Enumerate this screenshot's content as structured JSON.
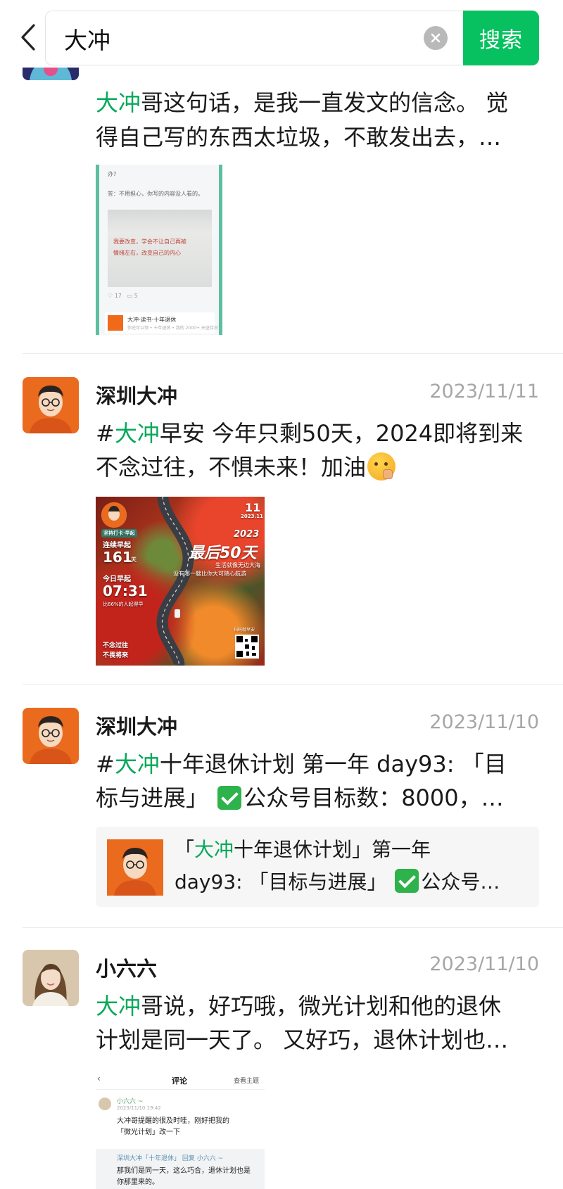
{
  "search": {
    "query": "大冲",
    "button_label": "搜索"
  },
  "posts": [
    {
      "text_line1_prefix": "哥这句话，是我一直发文的信念。 觉",
      "text_line2": "得自己写的东西太垃圾，不敢发出去，…",
      "highlight": "大冲",
      "image": {
        "question_tail": "办?",
        "answer": "答：不用担心，你写的内容没人看的。",
        "handwriting1": "我要改变，学会不让自己再被",
        "handwriting2": "情绪左右，改变自己的内心",
        "likes": "17",
        "comments": "5",
        "card_title": "大冲·读书·十年退休",
        "card_sub": "你还可以领 • 十年退休 • 我的 2000+ 天坚持日记"
      }
    },
    {
      "user": "深圳大冲",
      "date": "2023/11/11",
      "text_line1_hash": "#",
      "highlight": "大冲",
      "text_line1_rest": "早安 今年只剩50天，2024即将到来",
      "text_line2": "不念过往，不惧未来！加油",
      "image": {
        "badge": "坚持打卡·早起",
        "day": "11",
        "yearmonth": "2023.11",
        "year": "2023",
        "headline": "最后50天",
        "slogan1": "生活就像无边大海",
        "slogan2": "没有哪一艘比你大可随心航游",
        "streak_label": "连续早起",
        "streak_value": "161",
        "streak_unit": "天",
        "today_label": "今日早起",
        "today_time": "07:31",
        "rank": "比66%的人起得早",
        "footer1": "不念过往",
        "footer2": "不畏将来",
        "qr_label": "扫码就早安"
      }
    },
    {
      "user": "深圳大冲",
      "date": "2023/11/10",
      "text_line1_hash": "#",
      "highlight": "大冲",
      "text_line1_rest": "十年退休计划 第一年 day93: 「目",
      "text_line2_a": "标与进展」",
      "text_line2_b": "公众号目标数：8000，…",
      "card": {
        "line1_open": "「",
        "highlight": "大冲",
        "line1_rest": "十年退休计划」第一年",
        "line2_a": "day93: 「目标与进展」",
        "line2_b": "公众号…"
      }
    },
    {
      "user": "小六六",
      "date": "2023/11/10",
      "highlight": "大冲",
      "text_line1_rest": "哥说，好巧哦，微光计划和他的退休",
      "text_line2": "计划是同一天了。 又好巧，退休计划也…",
      "image": {
        "back": "‹",
        "title": "评论",
        "topic": "查看主题",
        "commenter": "小六六 ~",
        "time": "2023/11/10 19:42",
        "comment1": "大冲哥提醒的很及时哇，刚好把我的",
        "comment2": "「微光计划」改一下",
        "reply_head": "深圳大冲「十年退休」 回复 小六六 ~",
        "reply1": "那我们是同一天，这么巧合，退休计划也是",
        "reply2": "你那里来的。"
      }
    }
  ],
  "colors": {
    "accent": "#07c160",
    "highlight": "#07a85a",
    "date": "#a6a6a6"
  }
}
